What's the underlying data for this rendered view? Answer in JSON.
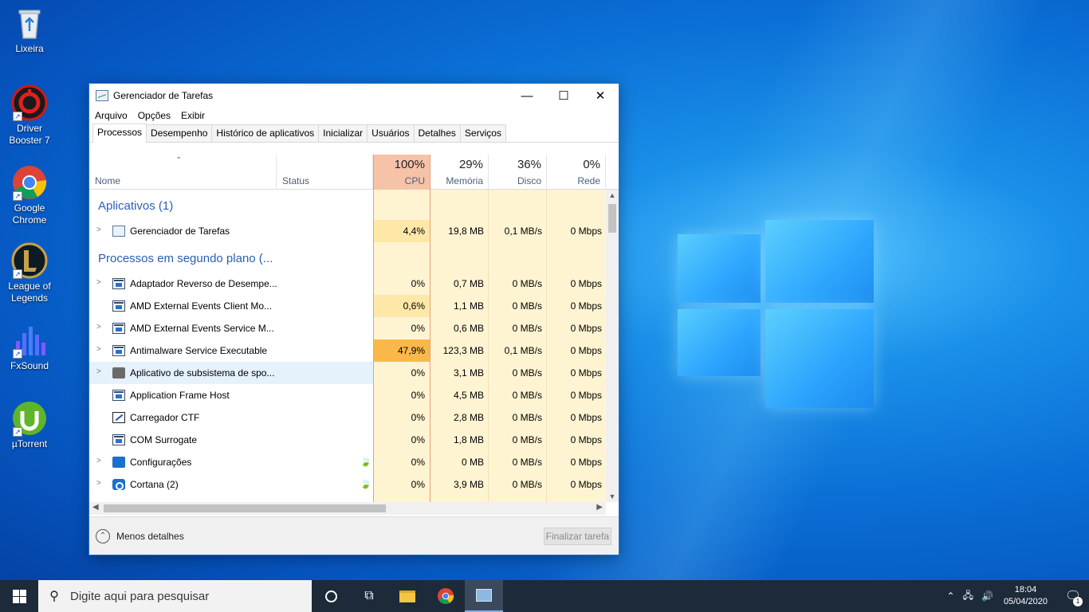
{
  "desktop": {
    "icons": [
      {
        "label": "Lixeira",
        "icon": "recycle-bin-icon"
      },
      {
        "label": "Driver Booster 7",
        "icon": "driver-booster-icon"
      },
      {
        "label": "Google Chrome",
        "icon": "chrome-icon"
      },
      {
        "label": "League of Legends",
        "icon": "league-of-legends-icon"
      },
      {
        "label": "FxSound",
        "icon": "fxsound-icon"
      },
      {
        "label": "µTorrent",
        "icon": "utorrent-icon"
      }
    ]
  },
  "window": {
    "title": "Gerenciador de Tarefas",
    "controls": {
      "minimize": "—",
      "maximize": "☐",
      "close": "✕"
    },
    "menu": [
      "Arquivo",
      "Opções",
      "Exibir"
    ],
    "tabs": [
      "Processos",
      "Desempenho",
      "Histórico de aplicativos",
      "Inicializar",
      "Usuários",
      "Detalhes",
      "Serviços"
    ],
    "active_tab": "Processos",
    "columns": {
      "name": "Nome",
      "status": "Status",
      "cpu": {
        "pct": "100%",
        "label": "CPU"
      },
      "memory": {
        "pct": "29%",
        "label": "Memória"
      },
      "disk": {
        "pct": "36%",
        "label": "Disco"
      },
      "network": {
        "pct": "0%",
        "label": "Rede"
      }
    },
    "groups": {
      "apps": "Aplicativos (1)",
      "background": "Processos em segundo plano (..."
    },
    "app_rows": [
      {
        "name": "Gerenciador de Tarefas",
        "cpu": "4,4%",
        "mem": "19,8 MB",
        "disk": "0,1 MB/s",
        "net": "0 Mbps",
        "expandable": true,
        "icon": "task-manager-icon"
      }
    ],
    "bg_rows": [
      {
        "name": "Adaptador Reverso de Desempe...",
        "cpu": "0%",
        "mem": "0,7 MB",
        "disk": "0 MB/s",
        "net": "0 Mbps",
        "expandable": true,
        "icon": "app-window-icon"
      },
      {
        "name": "AMD External Events Client Mo...",
        "cpu": "0,6%",
        "mem": "1,1 MB",
        "disk": "0 MB/s",
        "net": "0 Mbps",
        "expandable": false,
        "icon": "app-window-icon"
      },
      {
        "name": "AMD External Events Service M...",
        "cpu": "0%",
        "mem": "0,6 MB",
        "disk": "0 MB/s",
        "net": "0 Mbps",
        "expandable": true,
        "icon": "app-window-icon"
      },
      {
        "name": "Antimalware Service Executable",
        "cpu": "47,9%",
        "mem": "123,3 MB",
        "disk": "0,1 MB/s",
        "net": "0 Mbps",
        "expandable": true,
        "icon": "app-window-icon",
        "hot": true
      },
      {
        "name": "Aplicativo de subsistema de spo...",
        "cpu": "0%",
        "mem": "3,1 MB",
        "disk": "0 MB/s",
        "net": "0 Mbps",
        "expandable": true,
        "icon": "printer-icon",
        "selected": true
      },
      {
        "name": "Application Frame Host",
        "cpu": "0%",
        "mem": "4,5 MB",
        "disk": "0 MB/s",
        "net": "0 Mbps",
        "expandable": false,
        "icon": "app-window-icon"
      },
      {
        "name": "Carregador CTF",
        "cpu": "0%",
        "mem": "2,8 MB",
        "disk": "0 MB/s",
        "net": "0 Mbps",
        "expandable": false,
        "icon": "pen-icon"
      },
      {
        "name": "COM Surrogate",
        "cpu": "0%",
        "mem": "1,8 MB",
        "disk": "0 MB/s",
        "net": "0 Mbps",
        "expandable": false,
        "icon": "app-window-icon"
      },
      {
        "name": "Configurações",
        "cpu": "0%",
        "mem": "0 MB",
        "disk": "0 MB/s",
        "net": "0 Mbps",
        "expandable": true,
        "icon": "gear-icon",
        "suspended": true
      },
      {
        "name": "Cortana (2)",
        "cpu": "0%",
        "mem": "3,9 MB",
        "disk": "0 MB/s",
        "net": "0 Mbps",
        "expandable": true,
        "icon": "cortana-icon",
        "suspended": true
      }
    ],
    "footer": {
      "less_details": "Menos detalhes",
      "end_task": "Finalizar tarefa"
    }
  },
  "taskbar": {
    "search_placeholder": "Digite aqui para pesquisar",
    "time": "18:04",
    "date": "05/04/2020",
    "notification_count": "1"
  },
  "colors": {
    "cpu_header": "#f6c3a8",
    "cpu_column": "#fff0c8",
    "hot_cell": "#fbb84a",
    "warm_cell": "#fde8a8",
    "group_title": "#2a5fb0",
    "selected_row": "#e5f1fb"
  }
}
